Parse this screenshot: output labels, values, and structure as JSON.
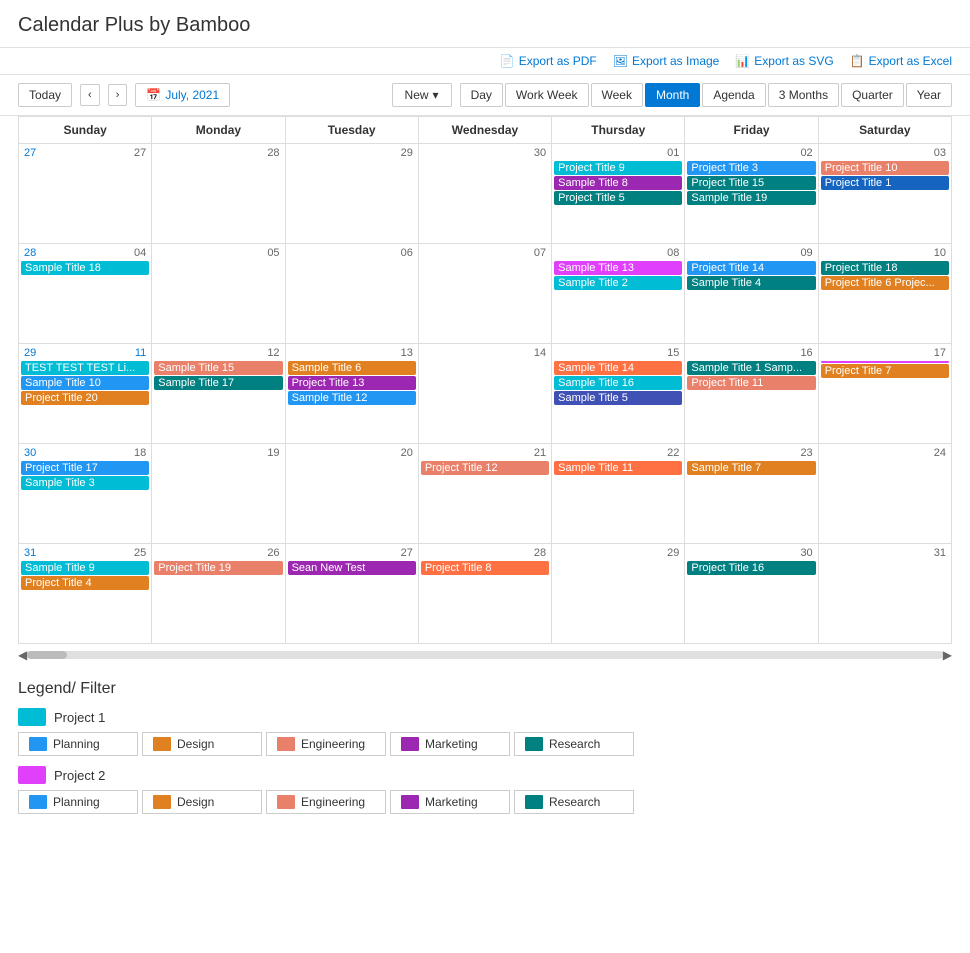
{
  "app": {
    "title": "Calendar Plus by Bamboo"
  },
  "toolbar": {
    "export_pdf": "Export as PDF",
    "export_image": "Export as Image",
    "export_svg": "Export as SVG",
    "export_excel": "Export as Excel"
  },
  "nav": {
    "today": "Today",
    "date": "July, 2021",
    "new_label": "New",
    "views": [
      "Day",
      "Work Week",
      "Week",
      "Month",
      "Agenda",
      "3 Months",
      "Quarter",
      "Year"
    ],
    "active_view": "Month"
  },
  "calendar": {
    "days": [
      "Sunday",
      "Monday",
      "Tuesday",
      "Wednesday",
      "Thursday",
      "Friday",
      "Saturday"
    ],
    "weeks": [
      {
        "week_num": "27",
        "days": [
          {
            "date": "27",
            "events": []
          },
          {
            "date": "28",
            "events": []
          },
          {
            "date": "29",
            "events": []
          },
          {
            "date": "30",
            "events": []
          },
          {
            "date": "01",
            "events": [
              {
                "title": "Project Title 9",
                "color": "ev-cyan"
              },
              {
                "title": "Sample Title 8",
                "color": "ev-purple"
              },
              {
                "title": "Project Title 5",
                "color": "ev-teal"
              }
            ]
          },
          {
            "date": "02",
            "events": [
              {
                "title": "Project Title 3",
                "color": "ev-blue"
              },
              {
                "title": "Project Title 15",
                "color": "ev-teal"
              },
              {
                "title": "Sample Title 19",
                "color": "ev-teal"
              }
            ]
          },
          {
            "date": "03",
            "events": [
              {
                "title": "Project Title 10",
                "color": "ev-pink"
              },
              {
                "title": "Project Title 1",
                "color": "ev-darkblue"
              }
            ]
          }
        ]
      },
      {
        "week_num": "28",
        "days": [
          {
            "date": "04",
            "events": [
              {
                "title": "Sample Title 18",
                "color": "ev-cyan"
              }
            ]
          },
          {
            "date": "05",
            "events": []
          },
          {
            "date": "06",
            "events": []
          },
          {
            "date": "07",
            "events": []
          },
          {
            "date": "08",
            "events": [
              {
                "title": "Sample Title 13",
                "color": "ev-magenta"
              },
              {
                "title": "Sample Title 2",
                "color": "ev-cyan"
              }
            ]
          },
          {
            "date": "09",
            "events": [
              {
                "title": "Project Title 14",
                "color": "ev-blue"
              },
              {
                "title": "Sample Title 4",
                "color": "ev-teal"
              }
            ]
          },
          {
            "date": "10",
            "events": [
              {
                "title": "Project Title 18",
                "color": "ev-teal"
              },
              {
                "title": "Project Title 6 Projec...",
                "color": "ev-orange"
              }
            ]
          }
        ]
      },
      {
        "week_num": "29",
        "days": [
          {
            "date": "11",
            "week_highlight": true,
            "events": [
              {
                "title": "TEST TEST TEST Li...",
                "color": "ev-cyan"
              },
              {
                "title": "Sample Title 10",
                "color": "ev-blue"
              },
              {
                "title": "Project Title 20",
                "color": "ev-orange"
              }
            ]
          },
          {
            "date": "12",
            "events": [
              {
                "title": "Sample Title 15",
                "color": "ev-pink"
              },
              {
                "title": "Sample Title 17",
                "color": "ev-teal"
              }
            ]
          },
          {
            "date": "13",
            "events": [
              {
                "title": "Sample Title 6",
                "color": "ev-orange"
              },
              {
                "title": "Project Title 13",
                "color": "ev-purple"
              },
              {
                "title": "Sample Title 12",
                "color": "ev-blue"
              }
            ]
          },
          {
            "date": "14",
            "events": []
          },
          {
            "date": "15",
            "events": [
              {
                "title": "Sample Title 14",
                "color": "ev-coral"
              },
              {
                "title": "Sample Title 16",
                "color": "ev-cyan"
              },
              {
                "title": "Sample Title 5",
                "color": "ev-indigo"
              }
            ]
          },
          {
            "date": "16",
            "events": [
              {
                "title": "Sample Title 1 Samp...",
                "color": "ev-teal"
              },
              {
                "title": "Project Title 11",
                "color": "ev-pink"
              }
            ]
          },
          {
            "date": "17",
            "events": [
              {
                "title": "",
                "color": "ev-magenta"
              },
              {
                "title": "Project Title 7",
                "color": "ev-orange"
              }
            ]
          }
        ]
      },
      {
        "week_num": "30",
        "days": [
          {
            "date": "18",
            "events": [
              {
                "title": "Project Title 17",
                "color": "ev-blue"
              },
              {
                "title": "Sample Title 3",
                "color": "ev-cyan"
              }
            ]
          },
          {
            "date": "19",
            "events": []
          },
          {
            "date": "20",
            "events": []
          },
          {
            "date": "21",
            "events": [
              {
                "title": "Project Title 12",
                "color": "ev-pink"
              }
            ]
          },
          {
            "date": "22",
            "events": [
              {
                "title": "Sample Title 11",
                "color": "ev-coral"
              }
            ]
          },
          {
            "date": "23",
            "events": [
              {
                "title": "Sample Title 7",
                "color": "ev-orange"
              }
            ]
          },
          {
            "date": "24",
            "events": []
          }
        ]
      },
      {
        "week_num": "31",
        "days": [
          {
            "date": "25",
            "events": [
              {
                "title": "Sample Title 9",
                "color": "ev-cyan"
              },
              {
                "title": "Project Title 4",
                "color": "ev-orange"
              }
            ]
          },
          {
            "date": "26",
            "events": [
              {
                "title": "Project Title 19",
                "color": "ev-pink"
              }
            ]
          },
          {
            "date": "27",
            "events": [
              {
                "title": "Sean New Test",
                "color": "ev-purple"
              }
            ]
          },
          {
            "date": "28",
            "events": [
              {
                "title": "Project Title 8",
                "color": "ev-coral"
              }
            ]
          },
          {
            "date": "29",
            "events": []
          },
          {
            "date": "30",
            "events": [
              {
                "title": "Project Title 16",
                "color": "ev-teal"
              }
            ]
          },
          {
            "date": "31",
            "events": []
          }
        ]
      }
    ]
  },
  "legend": {
    "title": "Legend/ Filter",
    "projects": [
      {
        "label": "Project 1",
        "color": "#00bcd4",
        "categories": [
          {
            "label": "Planning",
            "color": "#2196f3"
          },
          {
            "label": "Design",
            "color": "#e08020"
          },
          {
            "label": "Engineering",
            "color": "#e8806a"
          },
          {
            "label": "Marketing",
            "color": "#9c27b0"
          },
          {
            "label": "Research",
            "color": "#008080"
          }
        ]
      },
      {
        "label": "Project 2",
        "color": "#e040fb",
        "categories": [
          {
            "label": "Planning",
            "color": "#2196f3"
          },
          {
            "label": "Design",
            "color": "#e08020"
          },
          {
            "label": "Engineering",
            "color": "#e8806a"
          },
          {
            "label": "Marketing",
            "color": "#9c27b0"
          },
          {
            "label": "Research",
            "color": "#008080"
          }
        ]
      }
    ]
  }
}
